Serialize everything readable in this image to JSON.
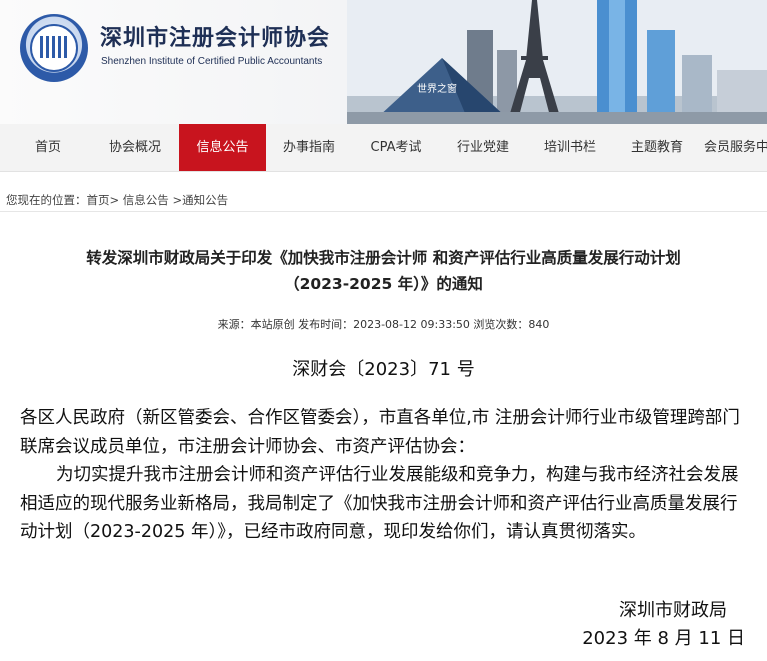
{
  "header": {
    "org_name_cn": "深圳市注册会计师协会",
    "org_name_en": "Shenzhen  Institute of Certified Public Accountants"
  },
  "nav": {
    "items": [
      "首页",
      "协会概况",
      "信息公告",
      "办事指南",
      "CPA考试",
      "行业党建",
      "培训书栏",
      "主题教育",
      "会员服务中"
    ],
    "active_index": 2
  },
  "breadcrumb": {
    "prefix": "您现在的位置：",
    "path": "首页> 信息公告 >通知公告"
  },
  "article": {
    "title_line1": "转发深圳市财政局关于印发《加快我市注册会计师 和资产评估行业高质量发展行动计划",
    "title_line2": "（2023-2025 年）》的通知",
    "meta": "来源：本站原创 发布时间：2023-08-12 09:33:50   浏览次数：840",
    "doc_number": "深财会〔2023〕71 号",
    "para1": "各区人民政府（新区管委会、合作区管委会），市直各单位,市 注册会计师行业市级管理跨部门联席会议成员单位，市注册会计师协会、市资产评估协会：",
    "para2": "为切实提升我市注册会计师和资产评估行业发展能级和竞争力，构建与我市经济社会发展相适应的现代服务业新格局，我局制定了《加快我市注册会计师和资产评估行业高质量发展行动计划（2023-2025 年）》，已经市政府同意，现印发给你们，请认真贯彻落实。",
    "signature": "深圳市财政局",
    "date": "2023 年 8 月 11 日"
  },
  "colors": {
    "nav_active": "#c8141e",
    "brand_blue": "#1e2f55"
  }
}
